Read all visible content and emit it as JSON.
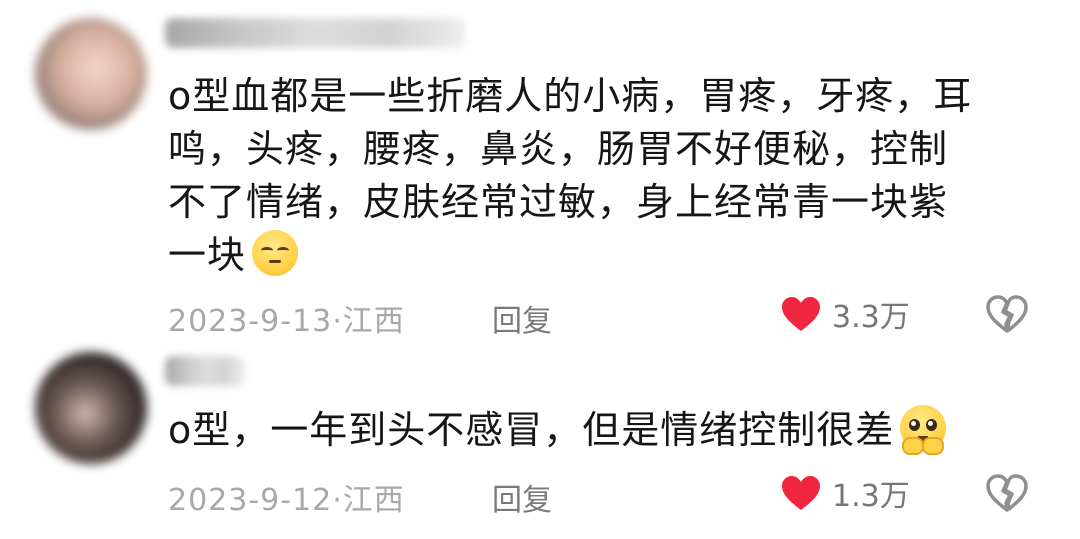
{
  "comments": [
    {
      "text_lines": [
        "o型血都是一些折磨人的小病，胃疼，牙疼，耳",
        "鸣，头疼，腰疼，鼻炎，肠胃不好便秘，控制",
        "不了情绪，皮肤经常过敏，身上经常青一块紫",
        "一块"
      ],
      "emoji": "unamused-face-emoji",
      "date_location": "2023-9-13·江西",
      "reply_label": "回复",
      "likes": "3.3万"
    },
    {
      "text_lines": [
        "o型，一年到头不感冒，但是情绪控制很差"
      ],
      "emoji": "pleading-face-emoji",
      "date_location": "2023-9-12·江西",
      "reply_label": "回复",
      "likes": "1.3万"
    }
  ],
  "colors": {
    "heart": "#f0253f",
    "meta_text": "#a8a8a8",
    "reply_text": "#7a7a7a",
    "like_count": "#777777"
  },
  "icons": [
    "heart-icon",
    "broken-heart-icon"
  ]
}
